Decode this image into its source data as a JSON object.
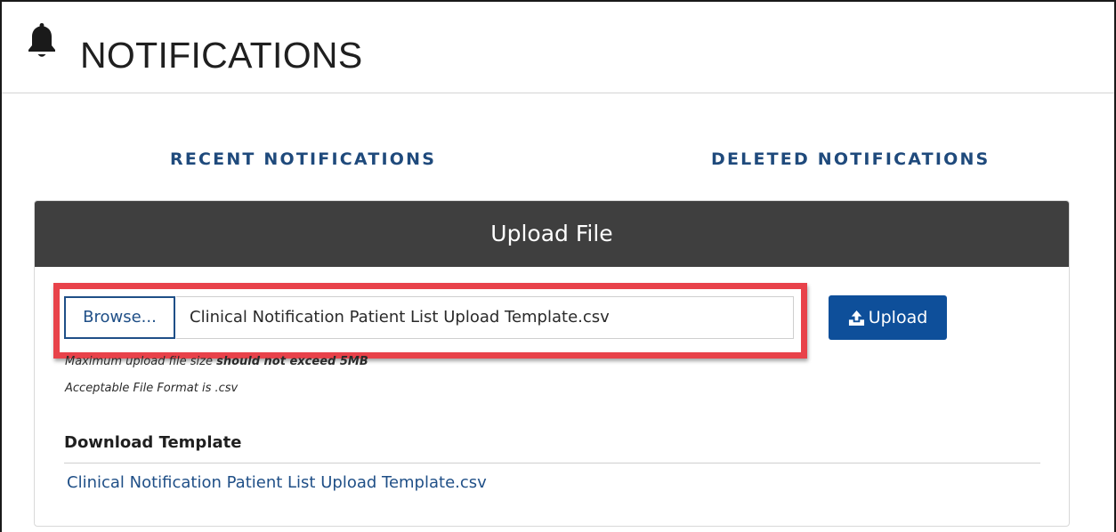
{
  "header": {
    "title": "NOTIFICATIONS",
    "icon": "bell-icon"
  },
  "tabs": [
    {
      "label": "RECENT NOTIFICATIONS"
    },
    {
      "label": "DELETED NOTIFICATIONS"
    }
  ],
  "upload_panel": {
    "title": "Upload File",
    "browse_label": "Browse...",
    "file_name": "Clinical Notification Patient List Upload Template.csv",
    "upload_label": "Upload",
    "upload_icon": "upload-icon",
    "size_note_prefix": "Maximum upload file size ",
    "size_note_bold": "should not exceed 5MB",
    "format_note": "Acceptable File Format is .csv",
    "download_heading": "Download Template",
    "template_link": "Clinical Notification Patient List Upload Template.csv"
  },
  "colors": {
    "accent": "#0e4f9a",
    "tab_text": "#1f4a7c",
    "panel_header": "#3f3f3f",
    "highlight": "#e8424a"
  }
}
